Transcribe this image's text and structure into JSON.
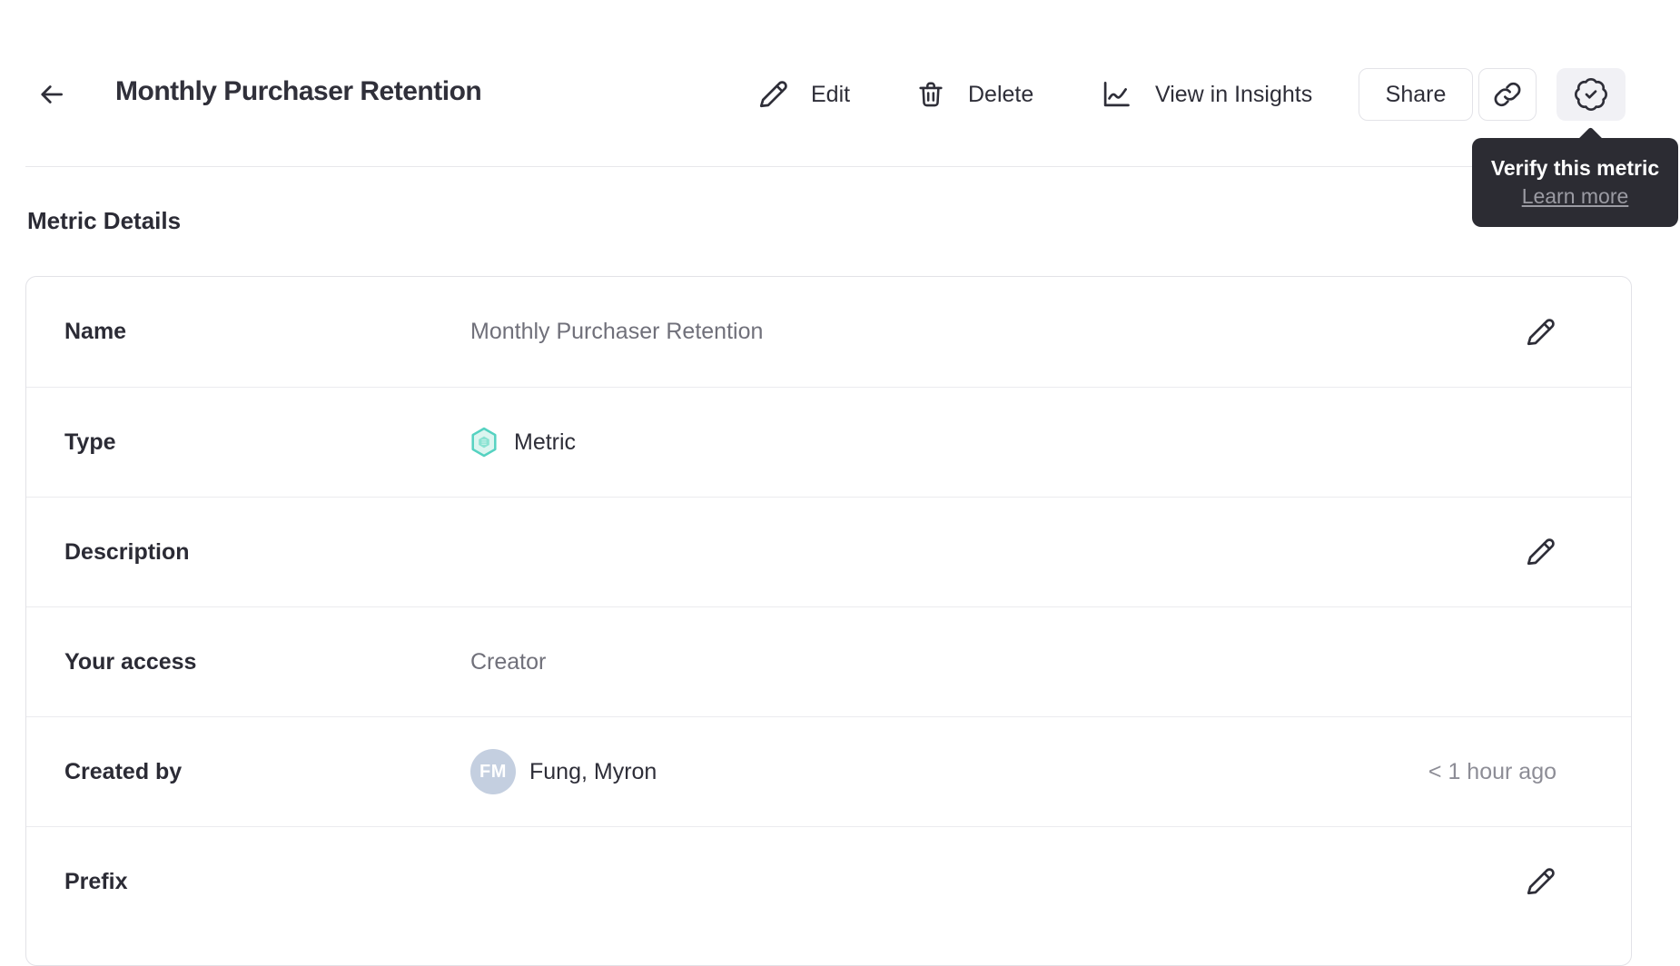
{
  "header": {
    "title": "Monthly Purchaser Retention",
    "back_icon": "arrow-left-icon",
    "actions": [
      {
        "label": "Edit",
        "icon": "pencil-icon"
      },
      {
        "label": "Delete",
        "icon": "trash-icon"
      },
      {
        "label": "View in Insights",
        "icon": "line-chart-icon"
      }
    ],
    "share_label": "Share",
    "link_button_icon": "link-icon",
    "verify_button_icon": "verified-badge-icon"
  },
  "tooltip": {
    "title": "Verify this metric",
    "link_label": "Learn more"
  },
  "section": {
    "heading": "Metric Details"
  },
  "details": {
    "rows": [
      {
        "label": "Name",
        "value": "Monthly Purchaser Retention",
        "editable": true
      },
      {
        "label": "Type",
        "value": "Metric",
        "icon": "metric-hexagon-icon"
      },
      {
        "label": "Description",
        "value": "",
        "editable": true
      },
      {
        "label": "Your access",
        "value": "Creator"
      },
      {
        "label": "Created by",
        "value": "Fung, Myron",
        "avatar_initials": "FM",
        "timestamp": "< 1 hour ago"
      },
      {
        "label": "Prefix",
        "value": "",
        "editable": true
      }
    ]
  },
  "colors": {
    "accent_teal": "#55d2c1",
    "teal_fill": "#dcf5f0",
    "tooltip_bg": "#2c2c33",
    "avatar_bg": "#c4cfe0",
    "text_dark": "#2e2e38",
    "text_gray": "#70707a",
    "timestamp_gray": "#8d8d96",
    "border": "#e2e2e7",
    "badge_button_bg": "#f1f1f5"
  }
}
